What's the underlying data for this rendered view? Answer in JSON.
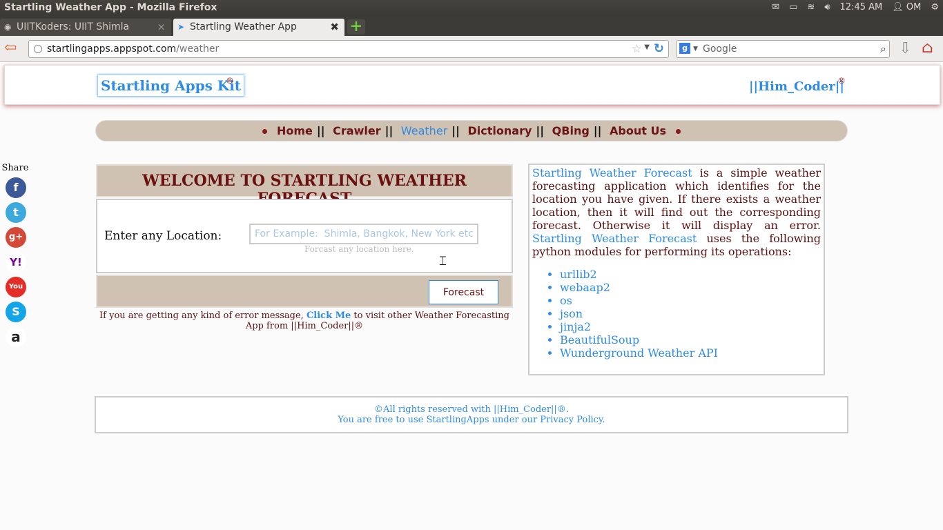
{
  "os": {
    "window_title": "Startling Weather App - Mozilla Firefox",
    "time": "12:45 AM",
    "user": "OM"
  },
  "tabs": [
    {
      "label": "UIITKoders: UIIT Shimla",
      "active": false
    },
    {
      "label": "Startling Weather App",
      "active": true
    }
  ],
  "nav": {
    "url_host": "startlingapps.appspot.com",
    "url_path": "/weather",
    "search_placeholder": "Google"
  },
  "header": {
    "brand": "Startling Apps Kit",
    "brand_mark": "®",
    "author": "||Him_Coder||",
    "author_mark": "®"
  },
  "menu": {
    "items": [
      "Home",
      "Crawler",
      "Weather",
      "Dictionary",
      "QBing",
      "About Us"
    ],
    "active": "Weather"
  },
  "share": {
    "title": "Share",
    "icons": [
      "facebook-icon",
      "twitter-icon",
      "google-plus-icon",
      "yahoo-icon",
      "youtube-icon",
      "skype-icon",
      "amazon-icon"
    ]
  },
  "weather": {
    "welcome": "WELCOME TO STARTLING WEATHER FORECAST",
    "location_label": "Enter any Location:",
    "location_placeholder": "For Example:  Shimla, Bangkok, New York etc.",
    "hint": "Forcast any location here.",
    "button": "Forecast",
    "error_before": "If you are getting any kind of error message, ",
    "error_link": "Click Me",
    "error_after": " to visit other Weather Forecasting App from ||Him_Coder||®"
  },
  "info": {
    "app_name": "Startling Weather Forecast",
    "text_1": " is a simple weather forecasting application which identifies for the location you have given. If there exists a weather location, then it will find out the corresponding forecast. Otherwise it will display an error. ",
    "app_name_2": "Startling Weather Forecast",
    "text_2": " uses the following python modules for performing its operations:",
    "modules": [
      "urllib2",
      "webaap2",
      "os",
      "json",
      "jinja2",
      "BeautifulSoup",
      "Wunderground Weather API"
    ]
  },
  "footer": {
    "line1": "©All rights reserved with ||Him_Coder||®.",
    "line2": "You are free to use StartlingApps under our Privacy Policy."
  },
  "colors": {
    "accent_blue": "#2e8be6",
    "maroon": "#6b0f0f",
    "tan": "#cfc2b3"
  }
}
